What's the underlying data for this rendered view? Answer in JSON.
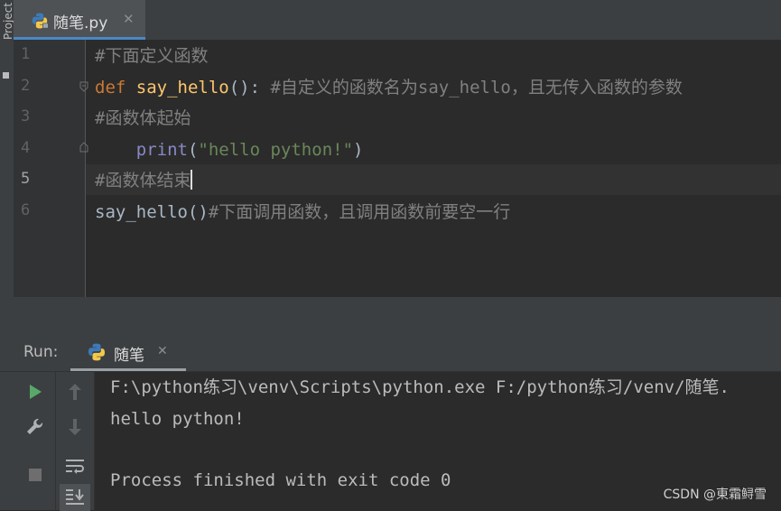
{
  "sidebar": {
    "project_tab": "Project"
  },
  "editor_tab": {
    "filename": "随笔.py",
    "close": "✕"
  },
  "editor": {
    "line_numbers": [
      "1",
      "2",
      "3",
      "4",
      "5",
      "6"
    ],
    "lines": [
      {
        "comment": "#下面定义函数"
      },
      {
        "kw": "def ",
        "fn": "say_hello",
        "plain": "(): ",
        "comment": "#自定义的函数名为say_hello，且无传入函数的参数"
      },
      {
        "comment": "#函数体起始"
      },
      {
        "indent": "    ",
        "builtin": "print",
        "plain_open": "(",
        "string": "\"hello python!\"",
        "plain_close": ")"
      },
      {
        "comment": "#函数体结束"
      },
      {
        "plain": "say_hello()",
        "comment": "#下面调用函数，且调用函数前要空一行"
      }
    ],
    "current_line": "5"
  },
  "run_panel": {
    "label": "Run:",
    "tab_name": "随笔",
    "close": "✕",
    "console": [
      "F:\\python练习\\venv\\Scripts\\python.exe F:/python练习/venv/随笔.",
      "hello python!",
      "",
      "Process finished with exit code 0"
    ]
  },
  "watermark": "CSDN @東霜鲟雪",
  "colors": {
    "keyword": "#cc7832",
    "function": "#ffc66d",
    "builtin": "#8888c6",
    "string": "#6a8759",
    "comment": "#808080",
    "run_green": "#59a869"
  }
}
